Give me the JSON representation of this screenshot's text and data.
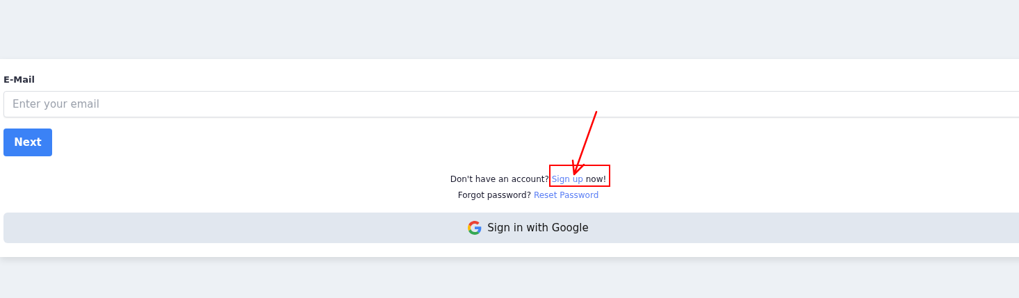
{
  "email_field": {
    "label": "E-Mail",
    "placeholder": "Enter your email"
  },
  "next_button": "Next",
  "signup_line": {
    "before": "Don't have an account?",
    "link": "Sign up",
    "after": "now!"
  },
  "reset_line": {
    "before": "Forgot password?",
    "link": "Reset Password"
  },
  "google_button": "Sign in with Google"
}
